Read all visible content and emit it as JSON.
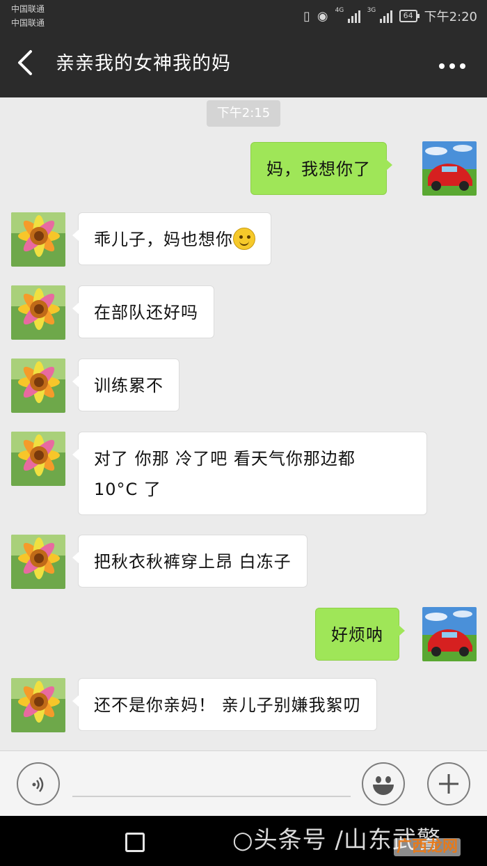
{
  "status_bar": {
    "carrier_1": "中国联通",
    "carrier_2": "中国联通",
    "net_1": "4G",
    "net_2": "3G",
    "battery": "64",
    "time": "下午2:20"
  },
  "header": {
    "back_icon": "chevron-left-icon",
    "title": "亲亲我的女神我的妈",
    "more_icon": "more-dots-icon"
  },
  "chat": {
    "timestamp": "下午2:15",
    "messages": [
      {
        "from": "me",
        "text": "妈，我想你了"
      },
      {
        "from": "mom",
        "text": "乖儿子，妈也想你",
        "emoji": "smile-emoji"
      },
      {
        "from": "mom",
        "text": "在部队还好吗"
      },
      {
        "from": "mom",
        "text": "训练累不"
      },
      {
        "from": "mom",
        "text": "对了 你那 冷了吧 看天气你那边都",
        "text_line2": "10°C 了"
      },
      {
        "from": "mom",
        "text": "把秋衣秋裤穿上昂 白冻子"
      },
      {
        "from": "me",
        "text": "好烦呐"
      },
      {
        "from": "mom",
        "text": "还不是你亲妈！ 亲儿子别嫌我絮叨"
      }
    ]
  },
  "input_bar": {
    "voice_icon": "voice-icon",
    "emoji_icon": "emoji-icon",
    "plus_icon": "plus-icon"
  },
  "nav_bar": {
    "watermark": "○头条号 /山东武警",
    "corner_mark": "广西龙网"
  }
}
